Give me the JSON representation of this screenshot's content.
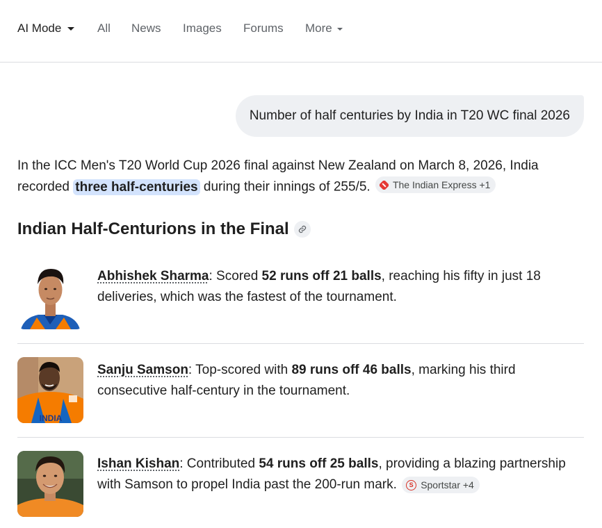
{
  "tabs": [
    {
      "label": "AI Mode",
      "active": true
    },
    {
      "label": "All"
    },
    {
      "label": "News"
    },
    {
      "label": "Images"
    },
    {
      "label": "Forums"
    },
    {
      "label": "More"
    }
  ],
  "query": "Number of half centuries by India in T20 WC final 2026",
  "intro": {
    "before": "In the ICC Men's T20 World Cup 2026 final against New Zealand on March 8, 2026, India recorded ",
    "highlight": "three half-centuries",
    "after": " during their innings of 255/5.",
    "source_chip": "The Indian Express +1"
  },
  "section_heading": "Indian Half-Centurions in the Final",
  "players": [
    {
      "name": "Abhishek Sharma",
      "pre": ": Scored ",
      "stat": "52 runs off 21 balls",
      "post": ", reaching his fifty in just 18 deliveries, which was the fastest of the tournament."
    },
    {
      "name": "Sanju Samson",
      "pre": ": Top-scored with ",
      "stat": "89 runs off 46 balls",
      "post": ", marking his third consecutive half-century in the tournament."
    },
    {
      "name": "Ishan Kishan",
      "pre": ": Contributed ",
      "stat": "54 runs off 25 balls",
      "post": ", providing a blazing partnership with Samson to propel India past the 200-run mark.",
      "source_chip": "Sportstar +4"
    }
  ],
  "jersey_text": "INDIA",
  "colors": {
    "highlight": "#d3e3fd",
    "bubble": "#eef0f3",
    "chip_bg": "#eef0f3",
    "divider": "#dadce0",
    "muted_text": "#5f6368"
  }
}
